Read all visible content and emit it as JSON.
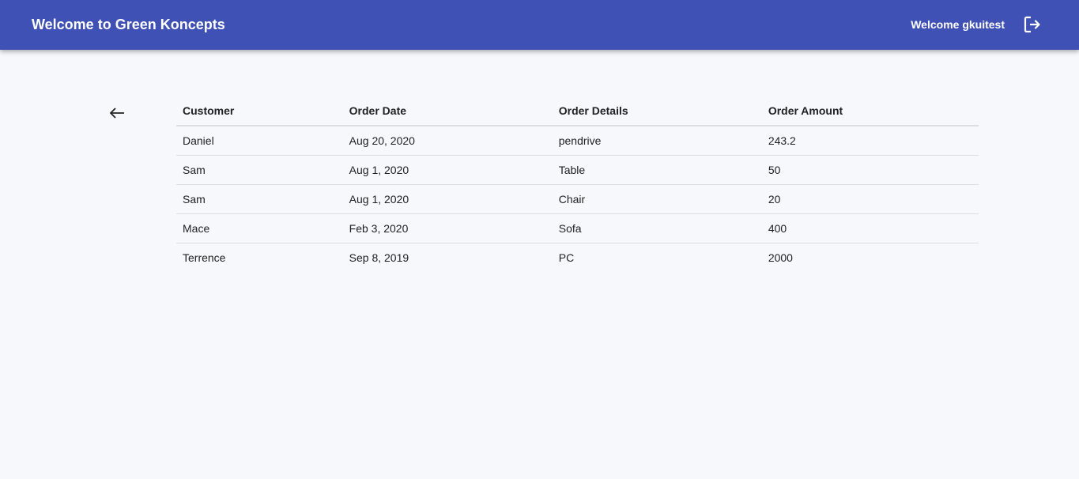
{
  "header": {
    "title": "Welcome to Green Koncepts",
    "welcome_text": "Welcome gkuitest",
    "logout_icon": "logout-icon",
    "background_color": "#3f51b5"
  },
  "navigation": {
    "back_icon": "arrow-left-icon"
  },
  "orders_table": {
    "columns": [
      "Customer",
      "Order Date",
      "Order Details",
      "Order Amount"
    ],
    "rows": [
      {
        "customer": "Daniel",
        "order_date": "Aug 20, 2020",
        "order_details": "pendrive",
        "order_amount": "243.2"
      },
      {
        "customer": "Sam",
        "order_date": "Aug 1, 2020",
        "order_details": "Table",
        "order_amount": "50"
      },
      {
        "customer": "Sam",
        "order_date": "Aug 1, 2020",
        "order_details": "Chair",
        "order_amount": "20"
      },
      {
        "customer": "Mace",
        "order_date": "Feb 3, 2020",
        "order_details": "Sofa",
        "order_amount": "400"
      },
      {
        "customer": "Terrence",
        "order_date": "Sep 8, 2019",
        "order_details": "PC",
        "order_amount": "2000"
      }
    ]
  }
}
